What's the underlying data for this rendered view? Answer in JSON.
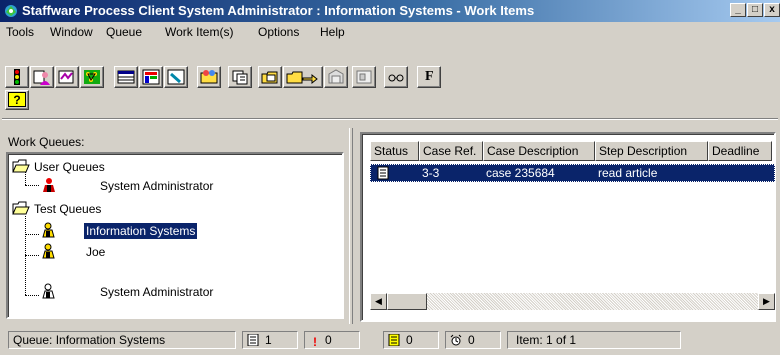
{
  "window": {
    "title": "Staffware Process Client System Administrator : Information Systems - Work Items",
    "minimize_glyph": "_",
    "maximize_glyph": "□",
    "close_glyph": "x"
  },
  "menu": {
    "tools": "Tools",
    "window": "Window",
    "queue": "Queue",
    "work_items": "Work Item(s)",
    "options": "Options",
    "help": "Help"
  },
  "toolbar": {
    "buttons": [
      "traffic-light-icon",
      "user-queue-icon",
      "work-queue-icon",
      "procedure-icon",
      "table-icon",
      "chart-icon",
      "check-icon",
      "folder-people-icon",
      "copy-icon",
      "open-item-icon",
      "forward-item-icon",
      "release-item-icon",
      "case-item-icon",
      "glasses-icon",
      "font-icon",
      "help-icon"
    ],
    "font_label": "F",
    "help_label": "?"
  },
  "left_pane": {
    "label": "Work Queues:",
    "tree": {
      "user_queues": "User Queues",
      "user_queues_child": "System Administrator",
      "test_queues": "Test Queues",
      "test_children": [
        "Information Systems",
        "Joe",
        "System Administrator"
      ],
      "selected": "Information Systems"
    }
  },
  "work_items": {
    "columns": [
      "Status",
      "Case Ref.",
      "Case Description",
      "Step Description",
      "Deadline"
    ],
    "rows": [
      {
        "status_icon": "work-item-icon",
        "case_ref": "3-3",
        "case_description": "case 235684",
        "step_description": "read article",
        "deadline": ""
      }
    ]
  },
  "status_bar": {
    "queue": "Queue: Information Systems",
    "count_items": "1",
    "count_urgent": "0",
    "count_new": "0",
    "count_deadline": "0",
    "item_position": "Item: 1 of 1"
  },
  "colors": {
    "title_gradient_start": "#0a246a",
    "title_gradient_end": "#a6caf0",
    "selection": "#0a246a",
    "face": "#d4d0c8"
  }
}
